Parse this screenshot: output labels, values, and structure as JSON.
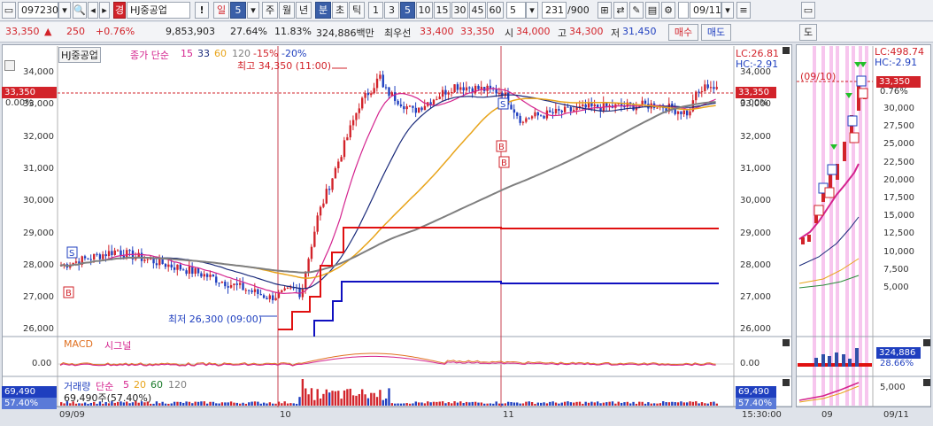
{
  "toolbar": {
    "code": "097230",
    "name": "HJ중공업",
    "badge": "경",
    "alert": "!",
    "period": "일",
    "period_value": "5",
    "tabs": [
      "주",
      "월",
      "년",
      "분",
      "초",
      "틱"
    ],
    "minutes": [
      "1",
      "3",
      "5",
      "10",
      "15",
      "30",
      "45",
      "60"
    ],
    "selected_minute": "5",
    "count_value": "5",
    "range": "231",
    "range_total": "/900",
    "date": "09/11"
  },
  "quote": {
    "price": "33,350",
    "change": "250",
    "change_pct": "+0.76%",
    "volume": "9,853,903",
    "turnover": "27.64%",
    "foreign": "11.83%",
    "amount": "324,886백만",
    "best_label": "최우선",
    "best_ask": "33,400",
    "best_bid": "33,350",
    "open_label": "시",
    "open": "34,000",
    "high_label": "고",
    "high": "34,300",
    "low_label": "저",
    "low": "31,450",
    "buy": "매수",
    "sell": "매도"
  },
  "main_chart": {
    "name": "HJ중공업",
    "ma_label": "종가 단순",
    "ma_periods": [
      "15",
      "33",
      "60",
      "120"
    ],
    "pct_lines": [
      "-15%",
      "-20%"
    ],
    "high_note": "최고 34,350 (11:00)",
    "low_note": "최저 26,300 (09:00)",
    "lc": "LC:26.81",
    "hc": "HC:-2.91",
    "current_price": "33,350",
    "current_pct": "0.00%",
    "y_ticks": [
      "34,000",
      "33,000",
      "32,000",
      "31,000",
      "30,000",
      "29,000",
      "28,000",
      "27,000",
      "26,000"
    ],
    "colors": {
      "ma15": "#d4238e",
      "ma33": "#1a2a7a",
      "ma60": "#e8a41a",
      "ma120": "#7f7f7f",
      "up": "#d2232a",
      "down": "#1f3fbf"
    }
  },
  "macd": {
    "title": "MACD",
    "signal": "시그널",
    "zero": "0.00"
  },
  "volume": {
    "title": "거래량",
    "ma_label": "단순",
    "periods": [
      "5",
      "20",
      "60",
      "120"
    ],
    "value_line": "69,490주(57.40%)",
    "box_value": "69,490",
    "box_pct": "57.40%"
  },
  "x_labels": [
    "09/09",
    "10",
    "11",
    "15:30:00"
  ],
  "side_chart": {
    "tab": "도",
    "lc": "LC:498.74",
    "hc": "HC:-2.91",
    "price": "33,350",
    "pct": "0.76%",
    "date_note": "(09/10)",
    "y_ticks": [
      "30,000",
      "27,500",
      "25,000",
      "22,500",
      "20,000",
      "17,500",
      "15,000",
      "12,500",
      "10,000",
      "7,500",
      "5,000"
    ],
    "vol_value": "324,886",
    "vol_pct": "28.66%",
    "vol_tick": "5,000",
    "x_labels": [
      "09",
      "09/11"
    ]
  }
}
